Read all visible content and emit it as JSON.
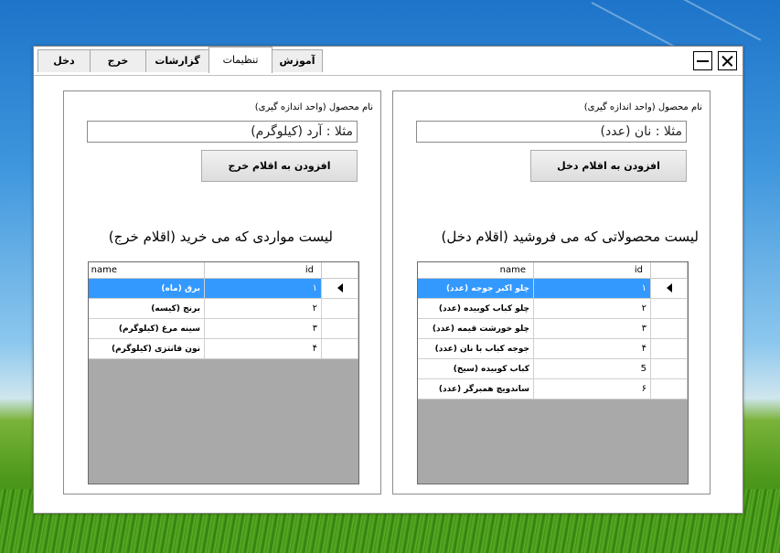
{
  "tabs": [
    {
      "label": "دخل",
      "w": 58
    },
    {
      "label": "خرج",
      "w": 62
    },
    {
      "label": "گزارشات",
      "w": 70
    },
    {
      "label": "تنظیمات",
      "w": 70,
      "active": true
    },
    {
      "label": "آموزش",
      "w": 56
    }
  ],
  "panels": {
    "expense": {
      "field_label": "نام محصول (واحد اندازه گیری)",
      "placeholder": "مثلا : آرد (کیلوگرم)",
      "button_label": "افزودن به اقلام خرج",
      "list_title": "لیست مواردی که می خرید (اقلام خرج)",
      "columns": {
        "id": "id",
        "name": "name"
      },
      "rows": [
        {
          "id": "١",
          "name": "برق (ماه)"
        },
        {
          "id": "٢",
          "name": "برنج (کیسه)"
        },
        {
          "id": "٣",
          "name": "سینه مرغ (کیلوگرم)"
        },
        {
          "id": "۴",
          "name": "نون فانتزی (کیلوگرم)"
        }
      ],
      "selected_row": 0
    },
    "income": {
      "field_label": "نام محصول (واحد اندازه گیری)",
      "placeholder": "مثلا : نان (عدد)",
      "button_label": "افزودن به اقلام دخل",
      "list_title": "لیست محصولاتی که می فروشید (اقلام دخل)",
      "columns": {
        "id": "id",
        "name": "name"
      },
      "rows": [
        {
          "id": "١",
          "name": "چلو اکبر جوجه (عدد)"
        },
        {
          "id": "٢",
          "name": "چلو کباب کوبیده (عدد)"
        },
        {
          "id": "٣",
          "name": "چلو خورشت قیمه (عدد)"
        },
        {
          "id": "۴",
          "name": "جوجه کباب با نان (عدد)"
        },
        {
          "id": "5",
          "name": "کباب کوبیده (سیخ)"
        },
        {
          "id": "۶",
          "name": "ساندویچ همبرگر (عدد)"
        }
      ],
      "selected_row": 0
    }
  },
  "colors": {
    "selection": "#3399ff",
    "grid_empty": "#a9a9a9"
  }
}
